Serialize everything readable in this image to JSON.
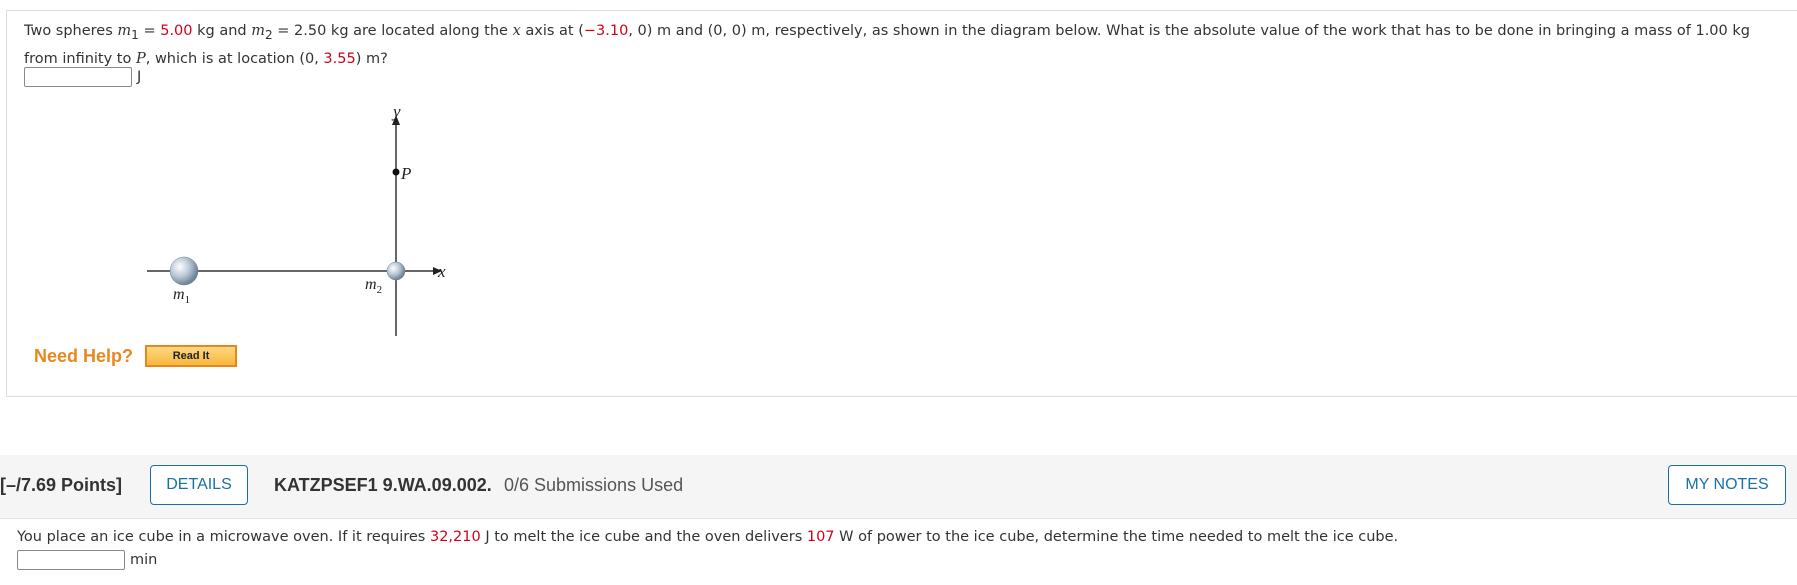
{
  "question1": {
    "text_intro": "Two spheres ",
    "m1_symbol": "m",
    "m1_sub": "1",
    "eq": " = ",
    "m1_value": "5.00",
    "kg_and": " kg  and  ",
    "m2_symbol": "m",
    "m2_sub": "2",
    "m2_text": " = 2.50 kg  are located along the ",
    "x_sym": "x",
    "axis_at": " axis at  (",
    "x1_value": "−3.10",
    "after_x1": ", 0) m  and  (0, 0) m,  respectively, as shown in the diagram below. What is the absolute value of the work that has to be done in bringing a mass of 1.00 kg from infinity to ",
    "p_sym": "P",
    "which_loc": ", which is at location  (0, ",
    "p_y_value": "3.55",
    "end": ") m?",
    "answer_value": "",
    "unit": "J"
  },
  "diagram": {
    "y_label": "y",
    "x_label": "x",
    "p_label": "P",
    "m1_label": "m",
    "m1_sub": "1",
    "m2_label": "m",
    "m2_sub": "2"
  },
  "help": {
    "need_help": "Need Help?",
    "read_it": "Read It"
  },
  "question2_header": {
    "points": "[–/7.69 Points]",
    "details": "DETAILS",
    "code": "KATZPSEF1 9.WA.09.002.",
    "submissions": "0/6 Submissions Used",
    "my_notes": "MY NOTES"
  },
  "question2": {
    "part1": "You place an ice cube in a microwave oven. If it requires ",
    "energy": "32,210",
    "part2": " J to melt the ice cube and the oven delivers ",
    "power": "107",
    "part3": " W of power to the ice cube, determine the time needed to melt the ice cube.",
    "answer_value": "",
    "unit": "min"
  }
}
